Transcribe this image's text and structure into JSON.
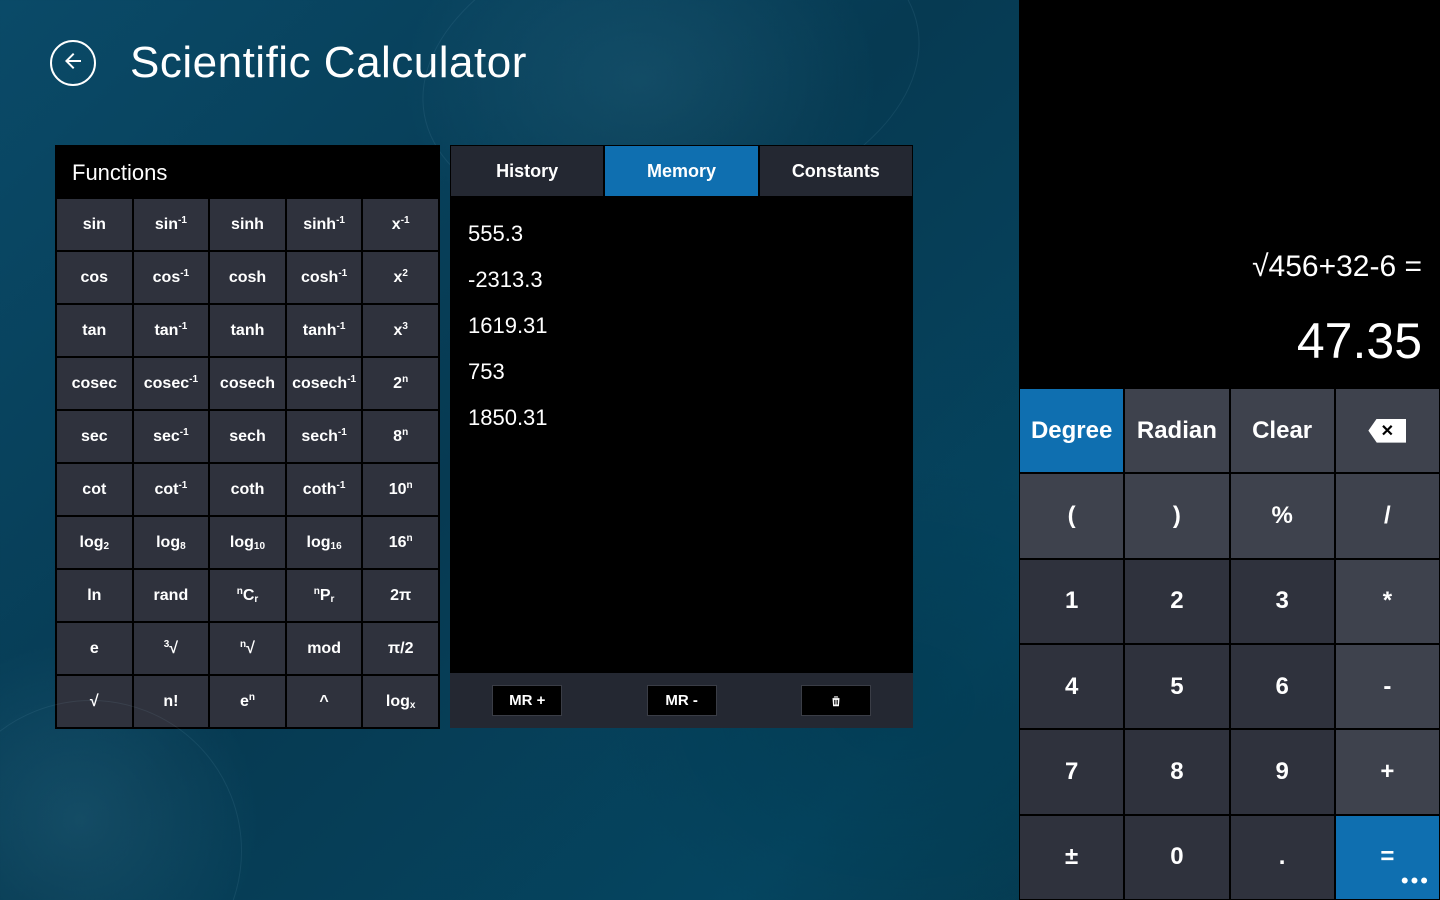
{
  "header": {
    "title": "Scientific Calculator"
  },
  "functions": {
    "heading": "Functions",
    "rows": [
      [
        {
          "b": "sin"
        },
        {
          "b": "sin",
          "sup": "-1"
        },
        {
          "b": "sinh"
        },
        {
          "b": "sinh",
          "sup": "-1"
        },
        {
          "b": "x",
          "sup": "-1"
        }
      ],
      [
        {
          "b": "cos"
        },
        {
          "b": "cos",
          "sup": "-1"
        },
        {
          "b": "cosh"
        },
        {
          "b": "cosh",
          "sup": "-1"
        },
        {
          "b": "x",
          "sup": "2"
        }
      ],
      [
        {
          "b": "tan"
        },
        {
          "b": "tan",
          "sup": "-1"
        },
        {
          "b": "tanh"
        },
        {
          "b": "tanh",
          "sup": "-1"
        },
        {
          "b": "x",
          "sup": "3"
        }
      ],
      [
        {
          "b": "cosec"
        },
        {
          "b": "cosec",
          "sup": "-1"
        },
        {
          "b": "cosech"
        },
        {
          "b": "cosech",
          "sup": "-1"
        },
        {
          "b": "2",
          "sup": "n"
        }
      ],
      [
        {
          "b": "sec"
        },
        {
          "b": "sec",
          "sup": "-1"
        },
        {
          "b": "sech"
        },
        {
          "b": "sech",
          "sup": "-1"
        },
        {
          "b": "8",
          "sup": "n"
        }
      ],
      [
        {
          "b": "cot"
        },
        {
          "b": "cot",
          "sup": "-1"
        },
        {
          "b": "coth"
        },
        {
          "b": "coth",
          "sup": "-1"
        },
        {
          "b": "10",
          "sup": "n"
        }
      ],
      [
        {
          "b": "log",
          "sub": "2"
        },
        {
          "b": "log",
          "sub": "8"
        },
        {
          "b": "log",
          "sub": "10"
        },
        {
          "b": "log",
          "sub": "16"
        },
        {
          "b": "16",
          "sup": "n"
        }
      ],
      [
        {
          "b": "ln"
        },
        {
          "b": "rand"
        },
        {
          "pre": "n",
          "b": "C",
          "sub": "r"
        },
        {
          "pre": "n",
          "b": "P",
          "sub": "r"
        },
        {
          "b": "2π"
        }
      ],
      [
        {
          "b": "e"
        },
        {
          "pre": "3",
          "b": "√"
        },
        {
          "pre": "n",
          "b": "√"
        },
        {
          "b": "mod"
        },
        {
          "b": "π/2"
        }
      ],
      [
        {
          "b": "√"
        },
        {
          "b": "n!"
        },
        {
          "b": "e",
          "sup": "n"
        },
        {
          "b": "^"
        },
        {
          "b": "log",
          "sub": "x"
        }
      ]
    ]
  },
  "center": {
    "tabs": {
      "history": "History",
      "memory": "Memory",
      "constants": "Constants",
      "active": "memory"
    },
    "memory_items": [
      "555.3",
      "-2313.3",
      "1619.31",
      "753",
      "1850.31"
    ],
    "actions": {
      "mr_plus": "MR +",
      "mr_minus": "MR -"
    }
  },
  "display": {
    "expression": "√456+32-6 =",
    "result": "47.35"
  },
  "keypad": {
    "degree": "Degree",
    "radian": "Radian",
    "clear": "Clear",
    "lparen": "(",
    "rparen": ")",
    "percent": "%",
    "div": "/",
    "k1": "1",
    "k2": "2",
    "k3": "3",
    "mul": "*",
    "k4": "4",
    "k5": "5",
    "k6": "6",
    "minus": "-",
    "k7": "7",
    "k8": "8",
    "k9": "9",
    "plus": "+",
    "pm": "±",
    "k0": "0",
    "dot": ".",
    "eq": "="
  }
}
